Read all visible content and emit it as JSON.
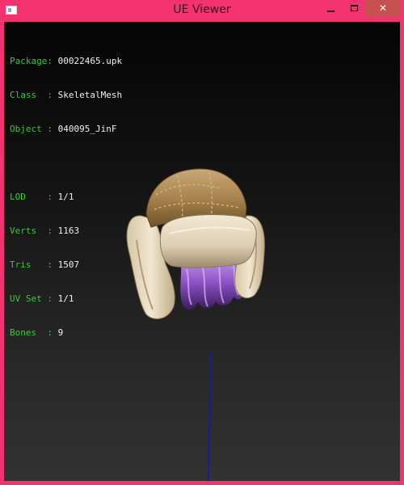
{
  "window": {
    "title": "UE Viewer",
    "controls": {
      "minimize": "",
      "maximize": "",
      "close": "✕"
    }
  },
  "info": {
    "package": {
      "label": "Package:",
      "value": "00022465.upk"
    },
    "class": {
      "label": "Class  :",
      "value": "SkeletalMesh"
    },
    "object": {
      "label": "Object :",
      "value": "040095_JinF"
    },
    "lod": {
      "label": "LOD    :",
      "value": "1/1"
    },
    "verts": {
      "label": "Verts  :",
      "value": "1163"
    },
    "tris": {
      "label": "Tris   :",
      "value": "1507"
    },
    "uvset": {
      "label": "UV Set :",
      "value": "1/1"
    },
    "bones": {
      "label": "Bones  :",
      "value": "9"
    }
  },
  "scene": {
    "model": "aviator hat with purple hair",
    "colors": {
      "accent_border": "#f2336f",
      "close_button": "#c75050",
      "info_label": "#2fd12f",
      "info_value": "#f0f0f0",
      "axis_line": "#1a1aa0"
    }
  }
}
